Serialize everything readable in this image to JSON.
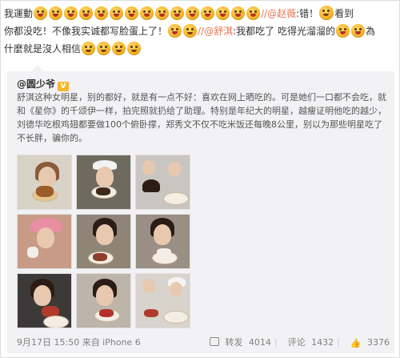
{
  "post": {
    "line1": {
      "prefix": "我運動",
      "mention": "//@赵薇",
      "after_mention": ":错！",
      "end": "看到"
    },
    "line2": {
      "text": "你都没吃！不像我实诚都写脸蛋上了！",
      "mention": "//@舒淇",
      "after_mention": ":我都吃了 吃得光溜溜的",
      "end": "為"
    },
    "line3": {
      "text": "什麼就是沒人相信"
    }
  },
  "repost": {
    "author": "@圆少爷",
    "vip_badge": "V",
    "text": "舒淇这种女明星，别的都好，就是有一点不好：喜欢在网上晒吃的。可是她们一口都不会吃，就和《星你》的千颂伊一样，拍完照就扔给了助理。特别是年纪大的明星，越瘦证明他吃的越少，刘德华吃根鸡翅都要做100个俯卧撑，郑秀文不仅不吃米饭还每晚8公里，别以为那些明星吃了不长胖，骗你的。",
    "photos": [
      {
        "name": "photo-1",
        "bg": "#d9d2c6"
      },
      {
        "name": "photo-2",
        "bg": "#6e6a5e"
      },
      {
        "name": "photo-3",
        "bg": "#c9c6c1"
      },
      {
        "name": "photo-4",
        "bg": "#c79b86"
      },
      {
        "name": "photo-5",
        "bg": "#8f8577"
      },
      {
        "name": "photo-6",
        "bg": "#9a8f85"
      },
      {
        "name": "photo-7",
        "bg": "#3c3a39"
      },
      {
        "name": "photo-8",
        "bg": "#bdb4aa"
      },
      {
        "name": "photo-9",
        "bg": "#d8d3cc"
      }
    ],
    "footer": {
      "timestamp": "9月17日 15:50 来自 iPhone 6",
      "repost_label": "转发",
      "repost_count": "4014",
      "comment_label": "评论",
      "comment_count": "1432",
      "like_count": "3376"
    }
  },
  "colors": {
    "mention": "#eb7350",
    "repost_bg": "#f2f2f5",
    "footer_text": "#808080"
  }
}
